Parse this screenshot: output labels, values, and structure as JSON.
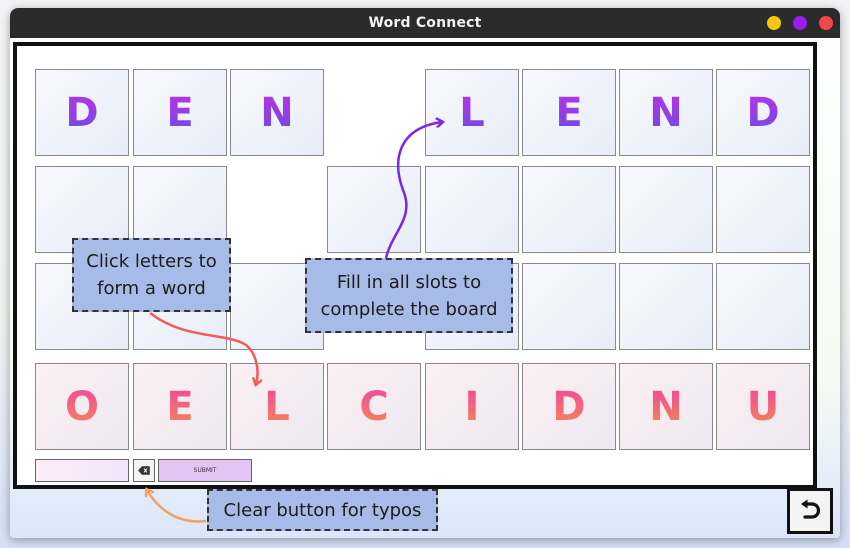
{
  "window": {
    "title": "Word Connect"
  },
  "board": {
    "top_left_word": [
      "D",
      "E",
      "N"
    ],
    "top_right_word": [
      "L",
      "E",
      "N",
      "D"
    ]
  },
  "letter_choices": [
    "O",
    "E",
    "L",
    "C",
    "I",
    "D",
    "N",
    "U"
  ],
  "controls": {
    "word_input_value": "",
    "submit_label": "SUBMIT"
  },
  "annotations": {
    "click_letters": "Click letters to form a word",
    "fill_slots": "Fill in all slots to complete the board",
    "clear_button": "Clear button for typos"
  },
  "icons": {
    "clear": "backspace-icon",
    "reset": "undo-icon"
  },
  "colors": {
    "annotation_bg": "#a7bbe8",
    "slot_letter_top": "#bb33e6",
    "slot_letter_bottom": "#6a4be0",
    "pick_letter_top": "#f0469e",
    "pick_letter_bottom": "#f48a52",
    "submit_bg": "#e3c5f5",
    "arrow_purple": "#7a28e6",
    "arrow_red": "#f45a5a",
    "arrow_orange": "#f4a063"
  }
}
